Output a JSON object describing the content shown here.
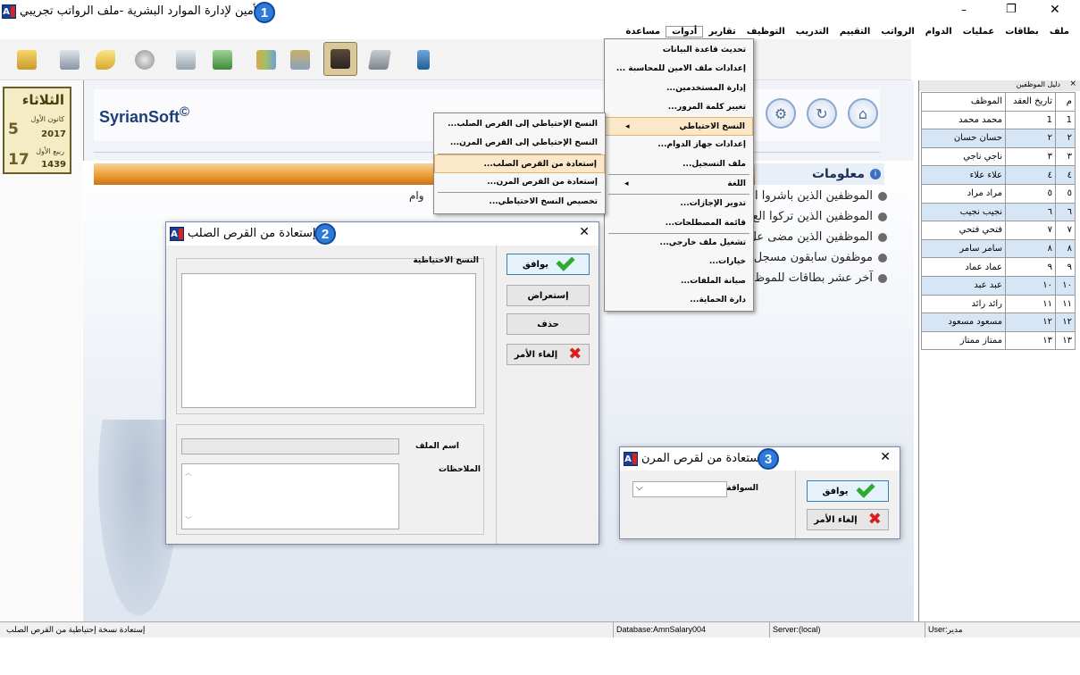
{
  "window": {
    "title": "الأمين لإدارة الموارد البشرية -ملف الرواتب تجريبي",
    "badge1": "1",
    "controls": {
      "minimize": "–",
      "restore": "❐",
      "close": "✕"
    }
  },
  "menubar": [
    "ملف",
    "بطاقات",
    "عمليات",
    "الدوام",
    "الرواتب",
    "التقييم",
    "التدريب",
    "التوظيف",
    "تقارير",
    "أدوات",
    "مساعدة"
  ],
  "toolbar": {
    "icons": [
      "folder-arrow-icon",
      "person-card-icon",
      "key-add-icon",
      "clock-icon",
      "calendar-clock-icon",
      "money-icon",
      "books-icon",
      "magnifier-book-icon",
      "people-icon",
      "calculator-icon",
      "exit-door-icon"
    ]
  },
  "calendar": {
    "day": "الثلاثاء",
    "greg_month": "كانون الأول",
    "greg_day": "5",
    "greg_year": "2017",
    "hijri_month": "ربيع الأول",
    "hijri_day": "17",
    "hijri_year": "1439"
  },
  "brand": {
    "name": "SyrianSoft",
    "mark": "©"
  },
  "info": {
    "header": "معلومات",
    "lines": [
      "الموظفين الذين باشروا ال",
      "الموظفين الذين تركوا الع",
      "الموظفين الذين مضى عل",
      "موظفون سابقون مسجل",
      "آخر عشر بطاقات للموظ"
    ],
    "fragment": "وام"
  },
  "tools_menu": {
    "items": [
      {
        "label": "تحديث قاعدة البيانات"
      },
      {
        "label": "إعدادات ملف الامين للمحاسبة ..."
      },
      {
        "label": "إدارة المستخدمين..."
      },
      {
        "label": "تغيير كلمة المرور..."
      },
      {
        "label": "النسخ الاحتياطي",
        "arrow": "◂"
      },
      {
        "label": "إعدادات جهاز الدوام..."
      },
      {
        "label": "ملف التسجيل..."
      },
      {
        "label": "اللغة",
        "arrow": "◂"
      },
      {
        "label": "تدوير الإجازات..."
      },
      {
        "label": "قائمة المصطلحات..."
      },
      {
        "label": "تشغيل ملف خارجي..."
      },
      {
        "label": "خيارات..."
      },
      {
        "label": "صيانة الملفات..."
      },
      {
        "label": "دارة الحماية..."
      }
    ]
  },
  "backup_submenu": {
    "items": [
      "النسخ الإحتياطي إلى القرص الصلب...",
      "النسخ الإحتياطي إلى القرص المرن...",
      "إستعادة من القرص الصلب...",
      "إستعادة من القرص المرن...",
      "تخصيص النسخ الاحتياطي..."
    ]
  },
  "dialog_hd": {
    "title": "إستعادة من القرص الصلب",
    "badge": "2",
    "backups_label": "النسخ الاحتياطية",
    "filename_label": "اسم الملف",
    "notes_label": "الملاحظات",
    "ok": "يوافق",
    "browse": "إستعراض",
    "delete": "حذف",
    "cancel": "إلغاء الأمر"
  },
  "dialog_fd": {
    "title": "إستعادة من لقرص المرن",
    "badge": "3",
    "drive_label": "السواقة",
    "ok": "يوافق",
    "cancel": "إلغاء الأمر"
  },
  "employee_panel": {
    "title": "دليل الموظفين",
    "columns": [
      "م",
      "تاريخ العقد",
      "الموظف"
    ],
    "rows": [
      [
        "1",
        "1",
        "محمد محمد"
      ],
      [
        "٢",
        "٢",
        "حسان حسان"
      ],
      [
        "٣",
        "٣",
        "ناجي ناجي"
      ],
      [
        "٤",
        "٤",
        "علاء علاء"
      ],
      [
        "٥",
        "٥",
        "مراد مراد"
      ],
      [
        "٦",
        "٦",
        "نجيب نجيب"
      ],
      [
        "٧",
        "٧",
        "فتحي فتحي"
      ],
      [
        "٨",
        "٨",
        "سامر سامر"
      ],
      [
        "٩",
        "٩",
        "عماد عماد"
      ],
      [
        "١٠",
        "١٠",
        "عبد عبد"
      ],
      [
        "١١",
        "١١",
        "رائد رائد"
      ],
      [
        "١٢",
        "١٢",
        "مسعود مسعود"
      ],
      [
        "١٣",
        "١٣",
        "ممتاز ممتاز"
      ]
    ]
  },
  "statusbar": {
    "message": "إستعادة نسخة إحتياطية من القرص الصلب",
    "database": "Database:AmnSalary004",
    "server": "Server:(local)",
    "user": "User:مدير"
  },
  "colors": {
    "accent": "#2e7ad8",
    "menu_highlight": "#fbe8c8",
    "row_alt": "#d6e6f7",
    "orange_band": "#e99a2c"
  }
}
